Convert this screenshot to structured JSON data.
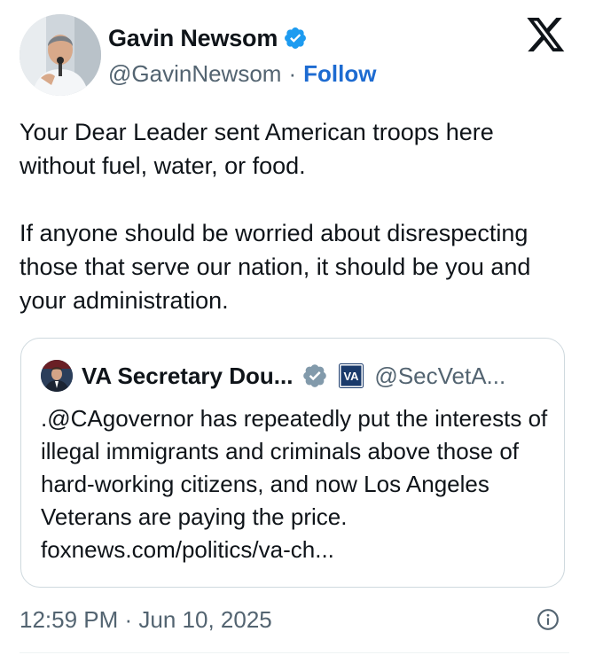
{
  "author": {
    "display_name": "Gavin Newsom",
    "handle": "@GavinNewsom",
    "separator": "·",
    "follow_label": "Follow",
    "verified_icon": "verified-badge-icon",
    "avatar_icon": "profile-photo"
  },
  "tweet": {
    "paragraphs": [
      "Your Dear Leader sent American troops here without fuel, water, or food.",
      "If anyone should be worried about disrespecting those that serve our nation, it should be you and your administration."
    ]
  },
  "quote": {
    "display_name": "VA Secretary Dou...",
    "handle": "@SecVetA...",
    "verified_icon": "gray-verified-badge-icon",
    "affiliation_badge": "VA",
    "text": ".@CAgovernor has repeatedly put the interests of illegal immigrants and criminals above those of hard-working citizens, and now Los Angeles Veterans are paying the price. foxnews.com/politics/va-ch..."
  },
  "meta": {
    "timestamp": "12:59 PM · Jun 10, 2025"
  },
  "colors": {
    "text": "#0f1419",
    "secondary": "#536471",
    "link": "#1d6bd1",
    "verified_blue": "#1d9bf0",
    "border": "#cfd9de"
  }
}
